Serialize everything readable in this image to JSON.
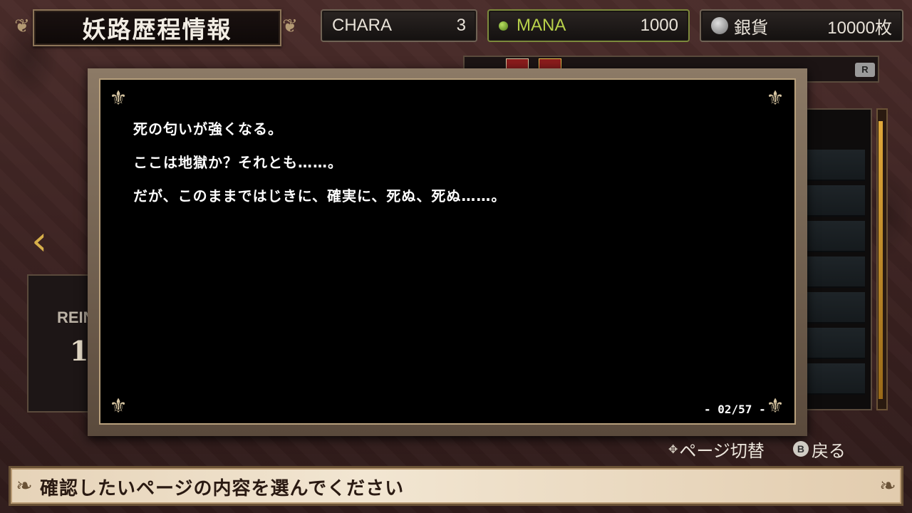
{
  "header": {
    "title": "妖路歴程情報",
    "stats": {
      "chara": {
        "label": "CHARA",
        "value": "3"
      },
      "mana": {
        "label": "MANA",
        "value": "1000"
      },
      "silver": {
        "label": "銀貨",
        "value": "10000枚"
      }
    }
  },
  "background": {
    "tab_badge": "R",
    "left_card_label": "REIN",
    "left_card_number": "1"
  },
  "story": {
    "lines": [
      "死の匂いが強くなる。",
      "ここは地獄か？それとも……。",
      "だが、このままではじきに、確実に、死ぬ、死ぬ……。"
    ],
    "page_indicator": "- 02/57 -"
  },
  "controls": {
    "page_switch": "ページ切替",
    "back_button_glyph": "B",
    "back": "戻る"
  },
  "help": {
    "text": "確認したいページの内容を選んでください"
  },
  "icons": {
    "mana": "green-orb-icon",
    "silver": "silver-coin-icon",
    "left_nav": "chevron-left-icon",
    "dpad": "dpad-icon",
    "b_button": "b-button-icon"
  },
  "colors": {
    "mana_accent": "#b8d14a",
    "scroll_accent": "#e0a83a"
  }
}
